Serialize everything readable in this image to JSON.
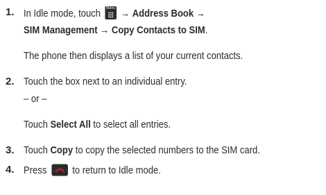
{
  "steps": [
    {
      "number": "1.",
      "line1_pre": "In Idle mode, touch",
      "icon_label": "Menu",
      "line1_post_arrow": "→",
      "line1_bold": "Address Book →",
      "line2_bold": "SIM Management → Copy Contacts to SIM",
      "line2_end": ".",
      "note": "The phone then displays a list of your current contacts."
    },
    {
      "number": "2.",
      "text": "Touch the box next to an individual entry.",
      "or": "– or –",
      "alt_pre": "Touch ",
      "alt_bold": "Select All",
      "alt_post": " to select all entries."
    },
    {
      "number": "3.",
      "pre": "Touch ",
      "bold": "Copy",
      "post": " to copy the selected numbers to the SIM card."
    },
    {
      "number": "4.",
      "pre": "Press ",
      "post": " to return to Idle mode."
    }
  ],
  "colors": {
    "text": "#2b2b2b",
    "icon_dark": "#2a2a2a",
    "end_key_red": "#b3202a"
  }
}
